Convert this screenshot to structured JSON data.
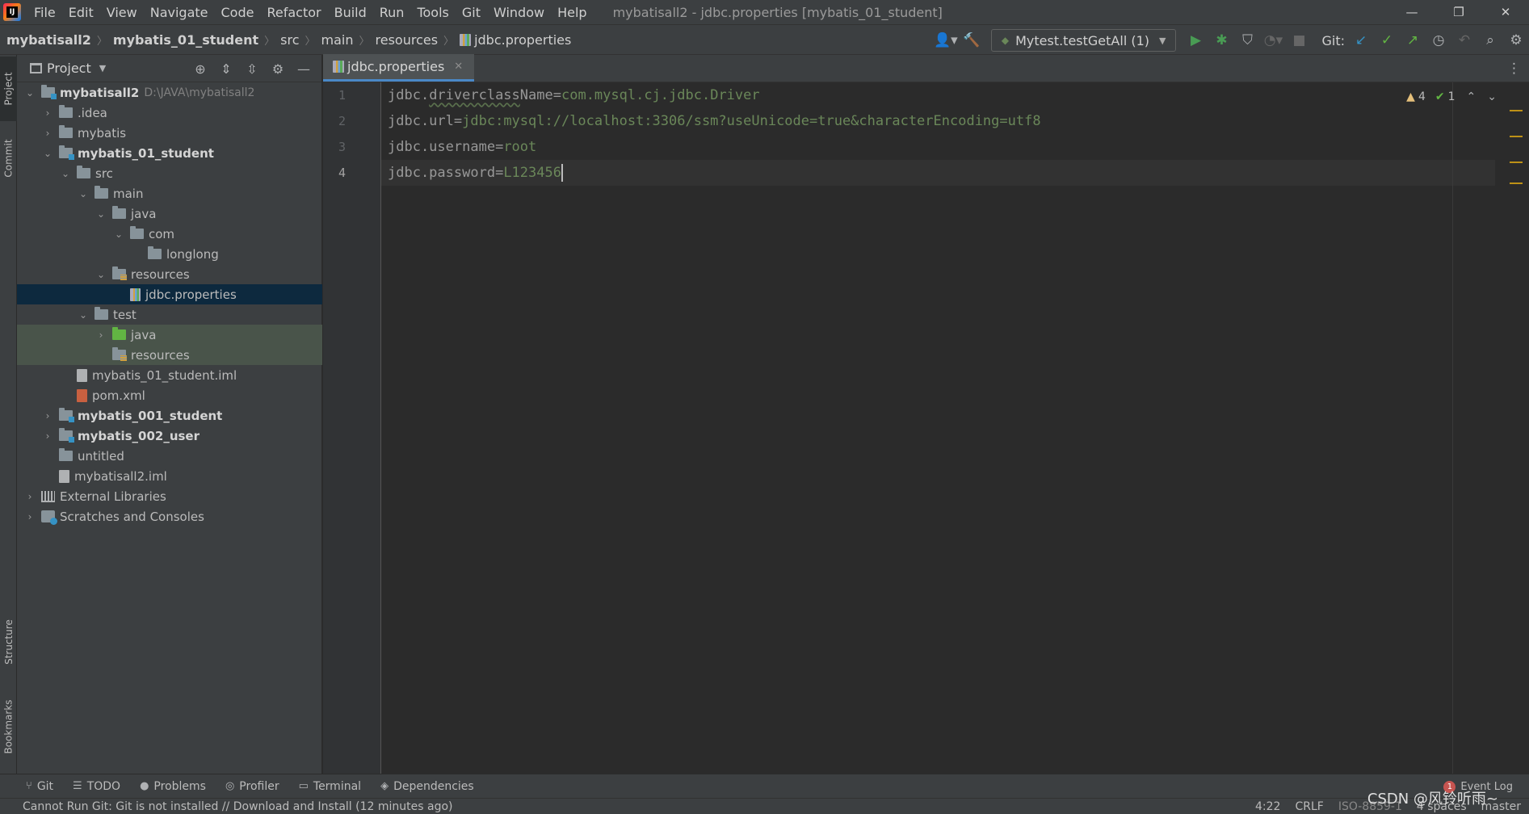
{
  "menu": {
    "items": [
      "File",
      "Edit",
      "View",
      "Navigate",
      "Code",
      "Refactor",
      "Build",
      "Run",
      "Tools",
      "Git",
      "Window",
      "Help"
    ]
  },
  "window": {
    "title": "mybatisall2 - jdbc.properties [mybatis_01_student]",
    "minimize": "—",
    "maximize": "❐",
    "close": "✕"
  },
  "breadcrumb": {
    "items": [
      "mybatisall2",
      "mybatis_01_student",
      "src",
      "main",
      "resources",
      "jdbc.properties"
    ]
  },
  "toolbar": {
    "run_config": "Mytest.testGetAll (1)",
    "git_label": "Git:",
    "icons": [
      "user-icon",
      "hammer-icon",
      "run-icon",
      "debug-icon",
      "coverage-icon",
      "profile-icon",
      "stop-icon",
      "git-update-icon",
      "git-commit-icon",
      "git-push-icon",
      "history-icon",
      "rollback-icon",
      "search-icon",
      "settings-icon"
    ]
  },
  "left_stripe": {
    "project": "Project",
    "commit": "Commit",
    "structure": "Structure",
    "bookmarks": "Bookmarks"
  },
  "project_panel": {
    "title": "Project",
    "tree": [
      {
        "label": "mybatisall2",
        "path": "D:\\JAVA\\mybatisall2",
        "level": 0,
        "expanded": true,
        "icon": "module",
        "bold": true
      },
      {
        "label": ".idea",
        "level": 1,
        "expanded": false,
        "icon": "folder"
      },
      {
        "label": "mybatis",
        "level": 1,
        "expanded": false,
        "icon": "folder"
      },
      {
        "label": "mybatis_01_student",
        "level": 1,
        "expanded": true,
        "icon": "module",
        "bold": true
      },
      {
        "label": "src",
        "level": 2,
        "expanded": true,
        "icon": "folder"
      },
      {
        "label": "main",
        "level": 3,
        "expanded": true,
        "icon": "folder"
      },
      {
        "label": "java",
        "level": 4,
        "expanded": true,
        "icon": "folder"
      },
      {
        "label": "com",
        "level": 5,
        "expanded": true,
        "icon": "folder"
      },
      {
        "label": "longlong",
        "level": 6,
        "icon": "folder"
      },
      {
        "label": "resources",
        "level": 4,
        "expanded": true,
        "icon": "resources"
      },
      {
        "label": "jdbc.properties",
        "level": 5,
        "icon": "properties",
        "selected": true
      },
      {
        "label": "test",
        "level": 3,
        "expanded": true,
        "icon": "folder"
      },
      {
        "label": "java",
        "level": 4,
        "expanded": false,
        "icon": "test-folder",
        "test": true
      },
      {
        "label": "resources",
        "level": 4,
        "icon": "test-resources",
        "test": true
      },
      {
        "label": "mybatis_01_student.iml",
        "level": 2,
        "icon": "file"
      },
      {
        "label": "pom.xml",
        "level": 2,
        "icon": "xml"
      },
      {
        "label": "mybatis_001_student",
        "level": 1,
        "expanded": false,
        "icon": "module",
        "bold": true
      },
      {
        "label": "mybatis_002_user",
        "level": 1,
        "expanded": false,
        "icon": "module",
        "bold": true
      },
      {
        "label": "untitled",
        "level": 1,
        "icon": "folder"
      },
      {
        "label": "mybatisall2.iml",
        "level": 1,
        "icon": "file"
      },
      {
        "label": "External Libraries",
        "level": 0,
        "expanded": false,
        "icon": "library"
      },
      {
        "label": "Scratches and Consoles",
        "level": 0,
        "expanded": false,
        "icon": "scratch"
      }
    ]
  },
  "editor": {
    "tab": "jdbc.properties",
    "current_line": 4,
    "lines": [
      {
        "num": "1",
        "key": "jdbc.",
        "key2": "driverclass",
        "key3": "Name",
        "eq": "=",
        "value": "com.mysql.cj.jdbc.Driver"
      },
      {
        "num": "2",
        "key": "jdbc.url",
        "eq": "=",
        "value": "jdbc:mysql://localhost:3306/ssm?useUnicode=true&characterEncoding=utf8"
      },
      {
        "num": "3",
        "key": "jdbc.username",
        "eq": "=",
        "value": "root"
      },
      {
        "num": "4",
        "key": "jdbc.password",
        "eq": "=",
        "value": "L123456"
      }
    ],
    "inspection": {
      "warnings": "4",
      "weak_warnings": "1"
    }
  },
  "bottom_tools": {
    "items": [
      {
        "label": "Git",
        "icon": "git-branch-icon"
      },
      {
        "label": "TODO",
        "icon": "todo-icon"
      },
      {
        "label": "Problems",
        "icon": "problems-icon"
      },
      {
        "label": "Profiler",
        "icon": "profiler-icon"
      },
      {
        "label": "Terminal",
        "icon": "terminal-icon"
      },
      {
        "label": "Dependencies",
        "icon": "dependencies-icon"
      }
    ],
    "event_log": "Event Log",
    "event_count": "1"
  },
  "statusbar": {
    "message": "Cannot Run Git: Git is not installed // Download and Install (12 minutes ago)",
    "position": "4:22",
    "line_sep": "CRLF",
    "encoding": "ISO-8859-1",
    "indent": "4 spaces",
    "branch": "master"
  },
  "watermark": "CSDN @风铃听雨~",
  "colors": {
    "accent": "#4a88c7",
    "selection": "#0d293e",
    "string_value": "#6a8759",
    "warning": "#be9117"
  }
}
